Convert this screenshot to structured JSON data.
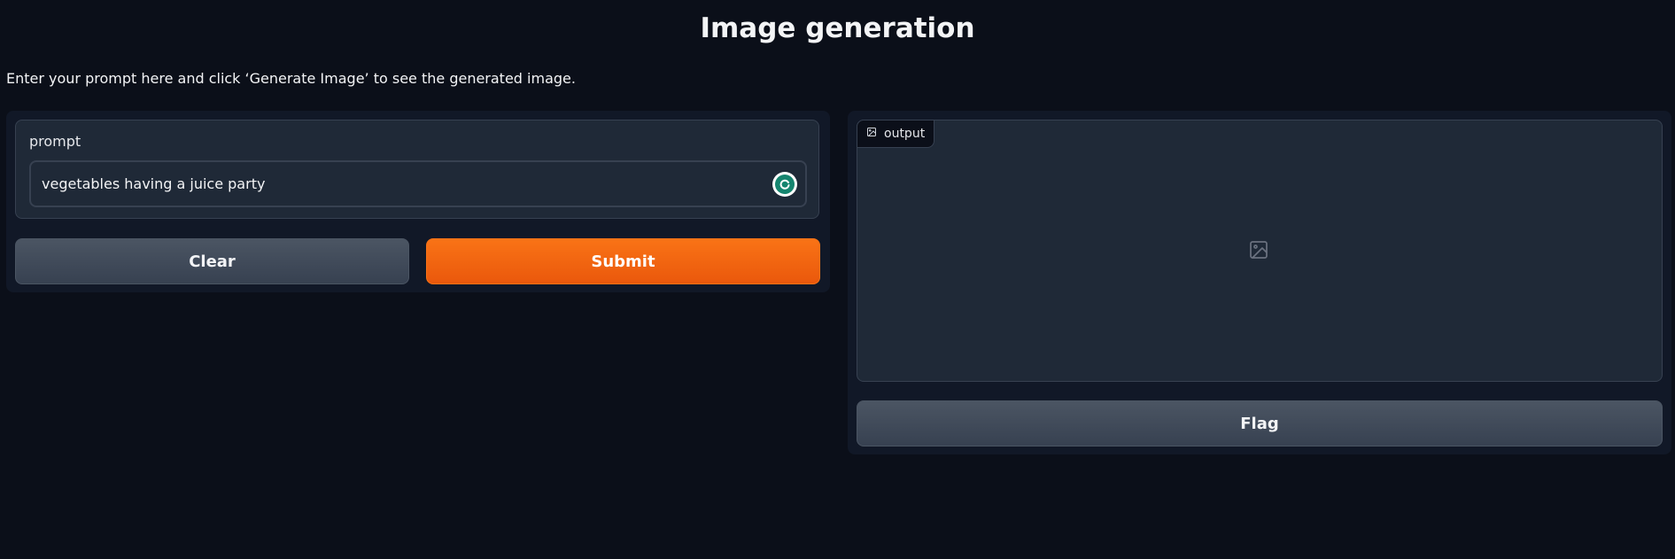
{
  "header": {
    "title": "Image generation",
    "description": "Enter your prompt here and click ‘Generate Image’ to see the generated image."
  },
  "input_panel": {
    "label": "prompt",
    "value": "vegetables having a juice party",
    "clear_label": "Clear",
    "submit_label": "Submit",
    "grammar_icon": "grammarly-icon"
  },
  "output_panel": {
    "label": "output",
    "label_icon": "image-icon",
    "placeholder_icon": "image-icon",
    "flag_label": "Flag"
  },
  "colors": {
    "background": "#0b0f19",
    "panel": "#111827",
    "block": "#1f2937",
    "accent": "#f97316",
    "secondary_button": "#4b5563"
  }
}
